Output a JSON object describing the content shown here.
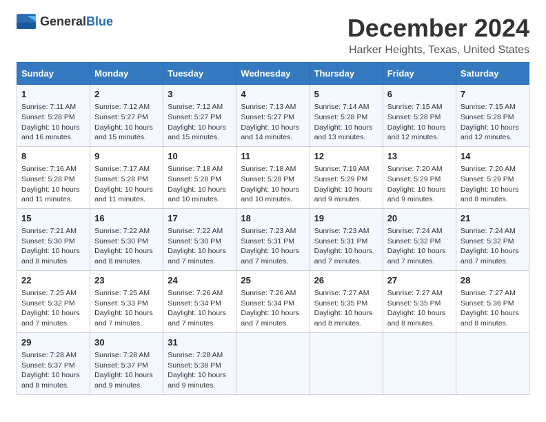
{
  "logo": {
    "text_general": "General",
    "text_blue": "Blue"
  },
  "title": "December 2024",
  "subtitle": "Harker Heights, Texas, United States",
  "days_of_week": [
    "Sunday",
    "Monday",
    "Tuesday",
    "Wednesday",
    "Thursday",
    "Friday",
    "Saturday"
  ],
  "weeks": [
    [
      {
        "day": 1,
        "info": "Sunrise: 7:11 AM\nSunset: 5:28 PM\nDaylight: 10 hours\nand 16 minutes."
      },
      {
        "day": 2,
        "info": "Sunrise: 7:12 AM\nSunset: 5:27 PM\nDaylight: 10 hours\nand 15 minutes."
      },
      {
        "day": 3,
        "info": "Sunrise: 7:12 AM\nSunset: 5:27 PM\nDaylight: 10 hours\nand 15 minutes."
      },
      {
        "day": 4,
        "info": "Sunrise: 7:13 AM\nSunset: 5:27 PM\nDaylight: 10 hours\nand 14 minutes."
      },
      {
        "day": 5,
        "info": "Sunrise: 7:14 AM\nSunset: 5:28 PM\nDaylight: 10 hours\nand 13 minutes."
      },
      {
        "day": 6,
        "info": "Sunrise: 7:15 AM\nSunset: 5:28 PM\nDaylight: 10 hours\nand 12 minutes."
      },
      {
        "day": 7,
        "info": "Sunrise: 7:15 AM\nSunset: 5:28 PM\nDaylight: 10 hours\nand 12 minutes."
      }
    ],
    [
      {
        "day": 8,
        "info": "Sunrise: 7:16 AM\nSunset: 5:28 PM\nDaylight: 10 hours\nand 11 minutes."
      },
      {
        "day": 9,
        "info": "Sunrise: 7:17 AM\nSunset: 5:28 PM\nDaylight: 10 hours\nand 11 minutes."
      },
      {
        "day": 10,
        "info": "Sunrise: 7:18 AM\nSunset: 5:28 PM\nDaylight: 10 hours\nand 10 minutes."
      },
      {
        "day": 11,
        "info": "Sunrise: 7:18 AM\nSunset: 5:28 PM\nDaylight: 10 hours\nand 10 minutes."
      },
      {
        "day": 12,
        "info": "Sunrise: 7:19 AM\nSunset: 5:29 PM\nDaylight: 10 hours\nand 9 minutes."
      },
      {
        "day": 13,
        "info": "Sunrise: 7:20 AM\nSunset: 5:29 PM\nDaylight: 10 hours\nand 9 minutes."
      },
      {
        "day": 14,
        "info": "Sunrise: 7:20 AM\nSunset: 5:29 PM\nDaylight: 10 hours\nand 8 minutes."
      }
    ],
    [
      {
        "day": 15,
        "info": "Sunrise: 7:21 AM\nSunset: 5:30 PM\nDaylight: 10 hours\nand 8 minutes."
      },
      {
        "day": 16,
        "info": "Sunrise: 7:22 AM\nSunset: 5:30 PM\nDaylight: 10 hours\nand 8 minutes."
      },
      {
        "day": 17,
        "info": "Sunrise: 7:22 AM\nSunset: 5:30 PM\nDaylight: 10 hours\nand 7 minutes."
      },
      {
        "day": 18,
        "info": "Sunrise: 7:23 AM\nSunset: 5:31 PM\nDaylight: 10 hours\nand 7 minutes."
      },
      {
        "day": 19,
        "info": "Sunrise: 7:23 AM\nSunset: 5:31 PM\nDaylight: 10 hours\nand 7 minutes."
      },
      {
        "day": 20,
        "info": "Sunrise: 7:24 AM\nSunset: 5:32 PM\nDaylight: 10 hours\nand 7 minutes."
      },
      {
        "day": 21,
        "info": "Sunrise: 7:24 AM\nSunset: 5:32 PM\nDaylight: 10 hours\nand 7 minutes."
      }
    ],
    [
      {
        "day": 22,
        "info": "Sunrise: 7:25 AM\nSunset: 5:32 PM\nDaylight: 10 hours\nand 7 minutes."
      },
      {
        "day": 23,
        "info": "Sunrise: 7:25 AM\nSunset: 5:33 PM\nDaylight: 10 hours\nand 7 minutes."
      },
      {
        "day": 24,
        "info": "Sunrise: 7:26 AM\nSunset: 5:34 PM\nDaylight: 10 hours\nand 7 minutes."
      },
      {
        "day": 25,
        "info": "Sunrise: 7:26 AM\nSunset: 5:34 PM\nDaylight: 10 hours\nand 7 minutes."
      },
      {
        "day": 26,
        "info": "Sunrise: 7:27 AM\nSunset: 5:35 PM\nDaylight: 10 hours\nand 8 minutes."
      },
      {
        "day": 27,
        "info": "Sunrise: 7:27 AM\nSunset: 5:35 PM\nDaylight: 10 hours\nand 8 minutes."
      },
      {
        "day": 28,
        "info": "Sunrise: 7:27 AM\nSunset: 5:36 PM\nDaylight: 10 hours\nand 8 minutes."
      }
    ],
    [
      {
        "day": 29,
        "info": "Sunrise: 7:28 AM\nSunset: 5:37 PM\nDaylight: 10 hours\nand 8 minutes."
      },
      {
        "day": 30,
        "info": "Sunrise: 7:28 AM\nSunset: 5:37 PM\nDaylight: 10 hours\nand 9 minutes."
      },
      {
        "day": 31,
        "info": "Sunrise: 7:28 AM\nSunset: 5:38 PM\nDaylight: 10 hours\nand 9 minutes."
      },
      null,
      null,
      null,
      null
    ]
  ]
}
